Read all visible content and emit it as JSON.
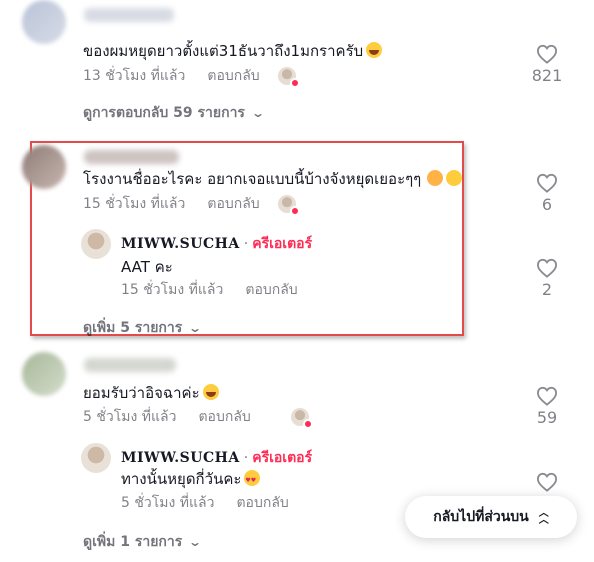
{
  "comments": [
    {
      "text": "ของผมหยุดยาวตั้งแต่31ธันวาถึง1มกราครับ",
      "emoji": "grinning-squinting-face",
      "time": "13 ชั่วโมง ที่แล้ว",
      "reply_label": "ตอบกลับ",
      "likes": "821",
      "view_replies": "ดูการตอบกลับ 59 รายการ"
    },
    {
      "text": "โรงงานชื่ออะไรคะ อยากเจอแบบนี้บ้างจังหยุดเยอะๆๆ",
      "emoji": "party-face, smiling-face",
      "time": "15 ชั่วโมง ที่แล้ว",
      "reply_label": "ตอบกลับ",
      "likes": "6",
      "reply": {
        "username": "MIWW.SUCHA",
        "separator": "·",
        "badge": "ครีเอเตอร์",
        "text": "AAT คะ",
        "time": "15 ชั่วโมง ที่แล้ว",
        "reply_label": "ตอบกลับ",
        "likes": "2"
      },
      "view_more": "ดูเพิ่ม 5 รายการ"
    },
    {
      "text": "ยอมรับว่าอิจฉาค่ะ",
      "emoji": "grinning-squinting-face",
      "time": "5 ชั่วโมง ที่แล้ว",
      "reply_label": "ตอบกลับ",
      "likes": "59",
      "reply": {
        "username": "MIWW.SUCHA",
        "separator": "·",
        "badge": "ครีเอเตอร์",
        "text": "ทางนั้นหยุดกี่วันคะ",
        "emoji": "heart-eyes-face",
        "time": "5 ชั่วโมง ที่แล้ว",
        "reply_label": "ตอบกลับ"
      },
      "view_more": "ดูเพิ่ม 1 รายการ"
    }
  ],
  "back_to_top": "กลับไปที่ส่วนบน",
  "colors": {
    "accent": "#fe2c55",
    "highlight_border": "#e34b4b",
    "muted_text": "#8a8b91"
  },
  "icons": [
    "heart-outline-icon",
    "chevron-down-icon",
    "double-chevron-up-icon"
  ]
}
